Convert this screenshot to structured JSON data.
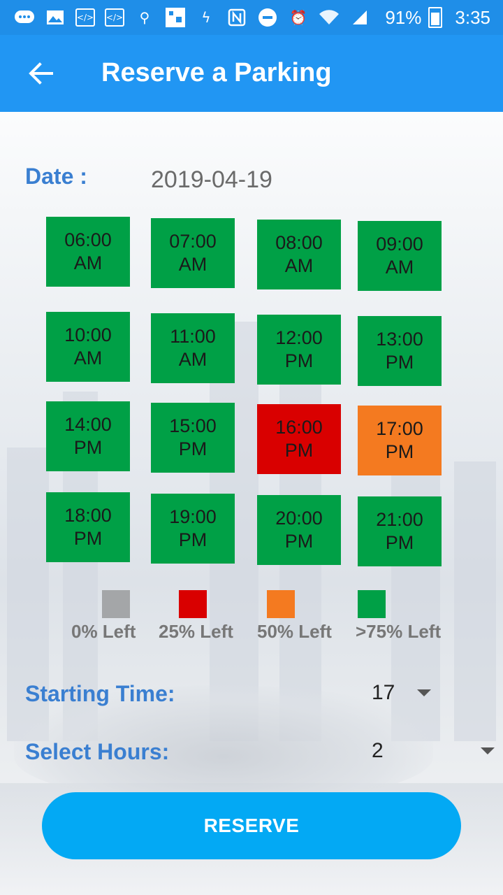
{
  "status_bar": {
    "battery": "91%",
    "time": "3:35",
    "icons": [
      "chat-icon",
      "image-icon",
      "code-icon",
      "code-icon",
      "usb-icon",
      "qr-icon",
      "flash-icon",
      "nfc-icon",
      "do-not-disturb-icon",
      "alarm-icon",
      "wifi-icon",
      "signal-icon",
      "battery-charging-icon"
    ]
  },
  "app_bar": {
    "title": "Reserve a Parking",
    "back_icon": "arrow-left-icon"
  },
  "date": {
    "label": "Date :",
    "value": "2019-04-19"
  },
  "colors": {
    "app_bar": "#2196f3",
    "status_bar": "#1f8ee8",
    "available": "#00a046",
    "quarter": "#d90000",
    "half": "#f47a20",
    "empty": "#a4a6a8",
    "label_blue": "#3a7fd1",
    "button": "#03a9f4"
  },
  "slots": [
    {
      "time": "06:00",
      "period": "AM",
      "status": "available"
    },
    {
      "time": "07:00",
      "period": "AM",
      "status": "available"
    },
    {
      "time": "08:00",
      "period": "AM",
      "status": "available"
    },
    {
      "time": "09:00",
      "period": "AM",
      "status": "available"
    },
    {
      "time": "10:00",
      "period": "AM",
      "status": "available"
    },
    {
      "time": "11:00",
      "period": "AM",
      "status": "available"
    },
    {
      "time": "12:00",
      "period": "PM",
      "status": "available"
    },
    {
      "time": "13:00",
      "period": "PM",
      "status": "available"
    },
    {
      "time": "14:00",
      "period": "PM",
      "status": "available"
    },
    {
      "time": "15:00",
      "period": "PM",
      "status": "available"
    },
    {
      "time": "16:00",
      "period": "PM",
      "status": "quarter"
    },
    {
      "time": "17:00",
      "period": "PM",
      "status": "half"
    },
    {
      "time": "18:00",
      "period": "PM",
      "status": "available"
    },
    {
      "time": "19:00",
      "period": "PM",
      "status": "available"
    },
    {
      "time": "20:00",
      "period": "PM",
      "status": "available"
    },
    {
      "time": "21:00",
      "period": "PM",
      "status": "available"
    }
  ],
  "legend": [
    {
      "label": "0% Left",
      "status": "empty"
    },
    {
      "label": "25% Left",
      "status": "quarter"
    },
    {
      "label": "50% Left",
      "status": "half"
    },
    {
      "label": ">75% Left",
      "status": "available"
    }
  ],
  "starting_time": {
    "label": "Starting Time:",
    "value": "17"
  },
  "select_hours": {
    "label": "Select Hours:",
    "value": "2"
  },
  "reserve_button": {
    "label": "RESERVE"
  }
}
